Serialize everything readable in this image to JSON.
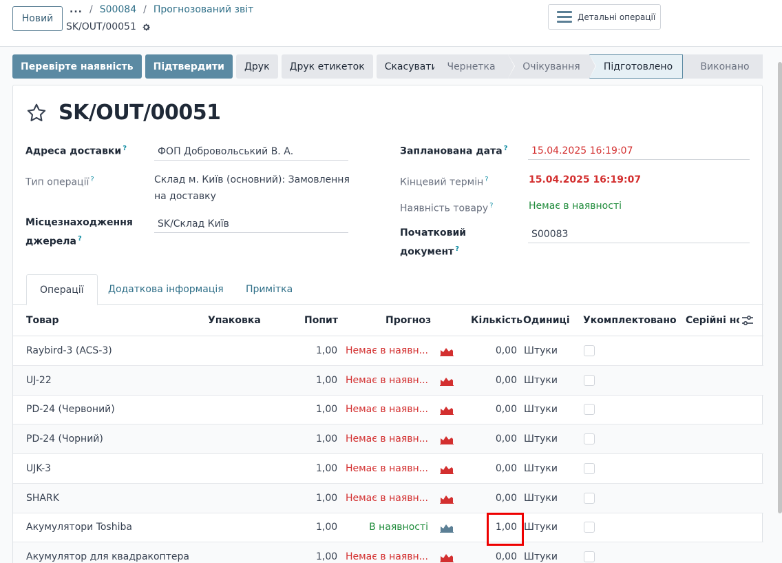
{
  "header": {
    "new_button": "Новий",
    "breadcrumb_dots": "...",
    "breadcrumb": [
      "S00084",
      "Прогнозований звіт"
    ],
    "record_name": "SK/OUT/00051",
    "detail_button": "Детальні операції"
  },
  "actions": [
    "Перевірте наявність",
    "Підтвердити",
    "Друк",
    "Друк етикеток",
    "Скасувати"
  ],
  "stages": [
    "Чернетка",
    "Очікування",
    "Підготовлено",
    "Виконано"
  ],
  "active_stage": "Підготовлено",
  "form": {
    "title": "SK/OUT/00051",
    "delivery_address_label": "Адреса доставки",
    "delivery_address": "ФОП Добровольський В. А.",
    "operation_type_label": "Тип операції",
    "operation_type": "Склад м. Київ (основний): Замовлення на доставку",
    "source_location_label_1": "Місцезнаходження",
    "source_location_label_2": "джерела",
    "source_location": "SK/Склад Київ",
    "scheduled_date_label": "Запланована дата",
    "scheduled_date": "15.04.2025 16:19:07",
    "deadline_label": "Кінцевий термін",
    "deadline": "15.04.2025 16:19:07",
    "availability_label": "Наявність товару",
    "availability": "Немає в наявності",
    "source_doc_label_1": "Початковий",
    "source_doc_label_2": "документ",
    "source_doc": "S00083",
    "help": "?"
  },
  "tabs": [
    "Операції",
    "Додаткова інформація",
    "Примітка"
  ],
  "table": {
    "headers": {
      "product": "Товар",
      "packaging": "Упаковка",
      "demand": "Попит",
      "forecast": "Прогноз",
      "quantity": "Кількість",
      "uom": "Одиниці",
      "picked": "Укомплектовано",
      "serials": "Серійні но"
    },
    "rows": [
      {
        "product": "Raybird-3 (ACS-3)",
        "demand": "1,00",
        "forecast": "Немає в наявн...",
        "status": "out",
        "quantity": "0,00",
        "uom": "Штуки"
      },
      {
        "product": "UJ-22",
        "demand": "1,00",
        "forecast": "Немає в наявн...",
        "status": "out",
        "quantity": "0,00",
        "uom": "Штуки"
      },
      {
        "product": "PD-24 (Червоний)",
        "demand": "1,00",
        "forecast": "Немає в наявн...",
        "status": "out",
        "quantity": "0,00",
        "uom": "Штуки"
      },
      {
        "product": "PD-24 (Чорний)",
        "demand": "1,00",
        "forecast": "Немає в наявн...",
        "status": "out",
        "quantity": "0,00",
        "uom": "Штуки"
      },
      {
        "product": "UJK-3",
        "demand": "1,00",
        "forecast": "Немає в наявн...",
        "status": "out",
        "quantity": "0,00",
        "uom": "Штуки"
      },
      {
        "product": "SHARK",
        "demand": "1,00",
        "forecast": "Немає в наявн...",
        "status": "out",
        "quantity": "0,00",
        "uom": "Штуки"
      },
      {
        "product": "Акумулятори Toshiba",
        "demand": "1,00",
        "forecast": "В наявності",
        "status": "in",
        "quantity": "1,00",
        "uom": "Штуки"
      },
      {
        "product": "Акумулятор для квадракоптера",
        "demand": "1,00",
        "forecast": "Немає в наявн...",
        "status": "out",
        "quantity": "0,00",
        "uom": "Штуки"
      }
    ]
  },
  "colors": {
    "primary": "#5b8aa3",
    "danger": "#d32f2f",
    "success": "#1e8b3a",
    "link": "#2f6f88",
    "highlight": "#ee0000"
  }
}
